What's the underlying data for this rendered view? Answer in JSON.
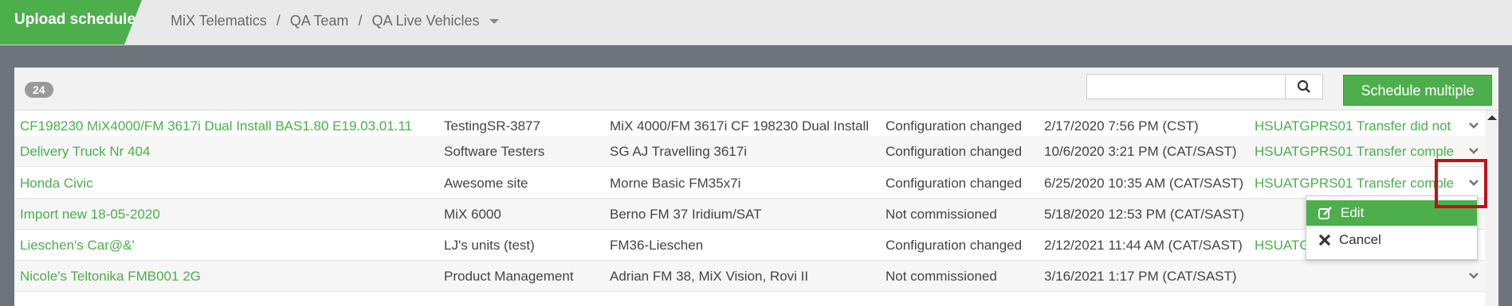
{
  "header": {
    "app_title": "Upload scheduler",
    "breadcrumbs": [
      "MiX Telematics",
      "QA Team",
      "QA Live Vehicles"
    ],
    "separator": "/"
  },
  "toolbar": {
    "count": "24",
    "search_placeholder": "",
    "schedule_label": "Schedule multiple"
  },
  "rows": [
    [
      "CF198230 MiX4000/FM 3617i Dual Install BAS1.80 E19.03.01.11",
      "TestingSR-3877",
      "MiX 4000/FM 3617i CF 198230 Dual Install",
      "Configuration changed",
      "2/17/2020 7:56 PM (CST)",
      "HSUATGPRS01 Transfer did not"
    ],
    [
      "Delivery Truck Nr 404",
      "Software Testers",
      "SG AJ Travelling 3617i",
      "Configuration changed",
      "10/6/2020 3:21 PM (CAT/SAST)",
      "HSUATGPRS01 Transfer comple"
    ],
    [
      "Honda Civic",
      "Awesome site",
      "Morne Basic FM35x7i",
      "Configuration changed",
      "6/25/2020 10:35 AM (CAT/SAST)",
      "HSUATGPRS01 Transfer comple"
    ],
    [
      "Import new 18-05-2020",
      "MiX 6000",
      "Berno FM 37 Iridium/SAT",
      "Not commissioned",
      "5/18/2020 12:53 PM (CAT/SAST)",
      ""
    ],
    [
      "Lieschen's Car@&'",
      "LJ's units (test)",
      "FM36-Lieschen",
      "Configuration changed",
      "2/12/2021 11:44 AM (CAT/SAST)",
      "HSUATG"
    ],
    [
      "Nicole's Teltonika FMB001 2G",
      "Product Management",
      "Adrian FM 38, MiX Vision, Rovi II",
      "Not commissioned",
      "3/16/2021 1:17 PM (CAT/SAST)",
      ""
    ]
  ],
  "menu": {
    "edit_label": "Edit",
    "cancel_label": "Cancel"
  },
  "colors": {
    "accent": "#4caf4c",
    "highlight": "#c0111a"
  }
}
